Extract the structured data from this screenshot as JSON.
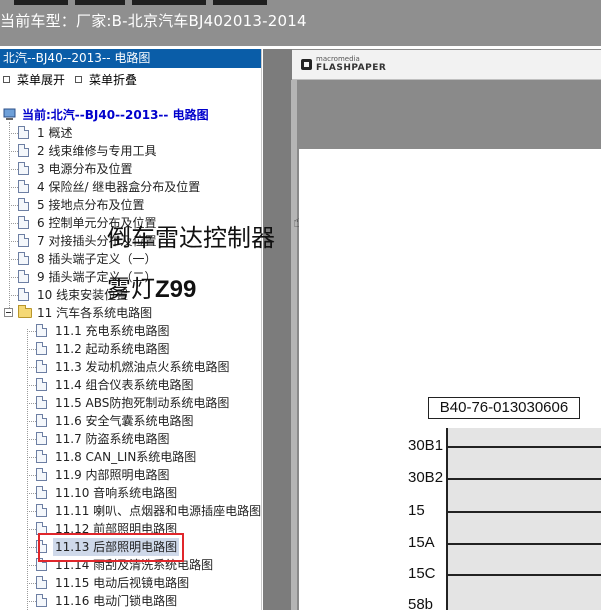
{
  "window": {
    "title": "当前车型：厂家:B-北京汽车BJ402013-2014"
  },
  "left_pane": {
    "header": "北汽--BJ40--2013-- 电路图",
    "expand_label": "菜单展开",
    "collapse_label": "菜单折叠",
    "root_label": "当前:北汽--BJ40--2013-- 电路图",
    "items": [
      {
        "label": "1 概述"
      },
      {
        "label": "2 线束维修与专用工具"
      },
      {
        "label": "3 电源分布及位置"
      },
      {
        "label": "4 保险丝/ 继电器盒分布及位置"
      },
      {
        "label": "5 接地点分布及位置"
      },
      {
        "label": "6 控制单元分布及位置"
      },
      {
        "label": "7 对接插头分布及位置"
      },
      {
        "label": "8 插头端子定义（一）"
      },
      {
        "label": "9 插头端子定义（二）"
      },
      {
        "label": "10 线束安装位置"
      },
      {
        "label": "11 汽车各系统电路图"
      }
    ],
    "sub_items": [
      {
        "label": "11.1 充电系统电路图"
      },
      {
        "label": "11.2 起动系统电路图"
      },
      {
        "label": "11.3 发动机燃油点火系统电路图"
      },
      {
        "label": "11.4 组合仪表系统电路图"
      },
      {
        "label": "11.5 ABS防抱死制动系统电路图"
      },
      {
        "label": "11.6 安全气囊系统电路图"
      },
      {
        "label": "11.7 防盗系统电路图"
      },
      {
        "label": "11.8 CAN_LIN系统电路图"
      },
      {
        "label": "11.9 内部照明电路图"
      },
      {
        "label": "11.10 音响系统电路图"
      },
      {
        "label": "11.11 喇叭、点烟器和电源插座电路图"
      },
      {
        "label": "11.12 前部照明电路图"
      },
      {
        "label": "11.13 后部照明电路图"
      },
      {
        "label": "11.14 雨刮及清洗系统电路图"
      },
      {
        "label": "11.15 电动后视镜电路图"
      },
      {
        "label": "11.16 电动门锁电路图"
      }
    ],
    "selected_item": "11.13 后部照明电路图"
  },
  "viewer": {
    "brand_top": "macromedia",
    "brand_bottom": "FLASHPAPER",
    "page_title_1": "倒车雷达控制器",
    "page_title_2_prefix": "雾灯",
    "page_title_2_code": "Z99",
    "connector_code": "B40-76-013030606",
    "pins": [
      "30B1",
      "30B2",
      "15",
      "15A",
      "15C",
      "58b"
    ]
  },
  "colors": {
    "header_blue": "#0a5da8",
    "highlight_red": "#e0262b",
    "root_blue": "#0000cc"
  }
}
